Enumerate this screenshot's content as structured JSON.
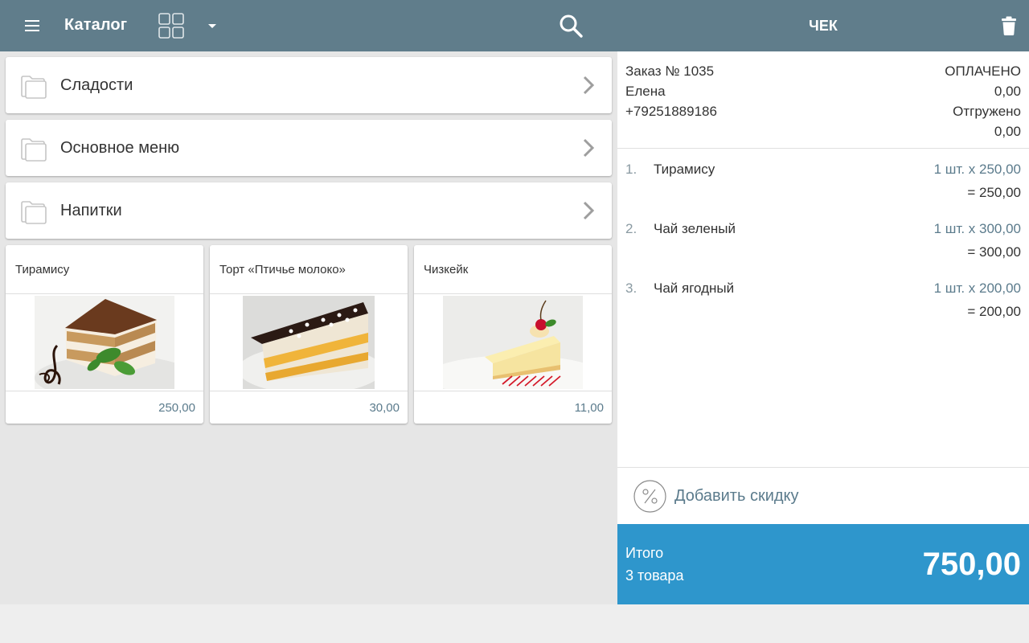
{
  "topbar": {
    "title": "Каталог",
    "receipt_title": "ЧЕК",
    "icons": [
      "menu-icon",
      "grid-view-icon",
      "dropdown-arrow-icon",
      "search-icon",
      "trash-icon"
    ],
    "background_color": "#607d8b"
  },
  "catalog": {
    "folders": [
      {
        "label": "Сладости"
      },
      {
        "label": "Основное меню"
      },
      {
        "label": "Напитки"
      }
    ],
    "products": [
      {
        "name": "Тирамису",
        "price": "250,00",
        "image": "tiramisu-photo"
      },
      {
        "name": "Торт «Птичье молоко»",
        "price": "30,00",
        "image": "cake-photo"
      },
      {
        "name": "Чизкейк",
        "price": "11,00",
        "image": "cheesecake-photo"
      }
    ],
    "price_color": "#5b7b8c"
  },
  "receipt": {
    "order_number": "Заказ № 1035",
    "status": "ОПЛАЧЕНО",
    "customer_name": "Елена",
    "paid_amount": "0,00",
    "phone": "+79251889186",
    "shipped_label": "Отгружено",
    "shipped_amount": "0,00",
    "items": [
      {
        "num": "1.",
        "name": "Тирамису",
        "qty": "1 шт. x 250,00",
        "sum": "= 250,00"
      },
      {
        "num": "2.",
        "name": "Чай зеленый",
        "qty": "1 шт. x 300,00",
        "sum": "= 300,00"
      },
      {
        "num": "3.",
        "name": "Чай ягодный",
        "qty": "1 шт. x 200,00",
        "sum": "= 200,00"
      }
    ],
    "discount_label": "Добавить скидку",
    "total_label": "Итого",
    "total_count": "3 товара",
    "total_amount": "750,00",
    "total_color": "#2e96cc"
  }
}
